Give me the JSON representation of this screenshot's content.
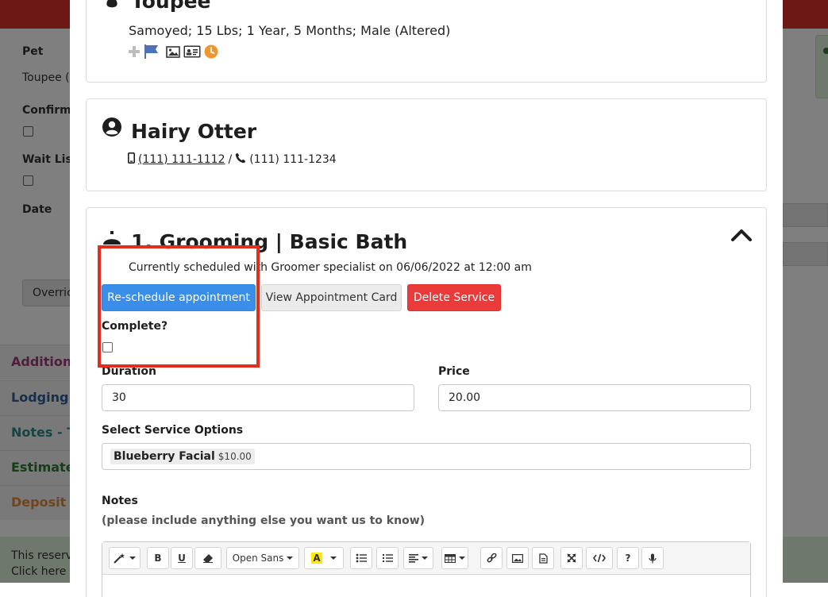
{
  "background": {
    "pet_label": "Pet",
    "pet_value": "Toupee (",
    "confirm_label": "Confirm",
    "wait_list_label": "Wait List",
    "date_label": "Date",
    "override_button": "Overric",
    "sections": [
      {
        "label": "Additiona",
        "color": "#a23a7a"
      },
      {
        "label": "Lodging -",
        "color": "#2f5f9a"
      },
      {
        "label": "Notes - To",
        "color": "#2a8a8a"
      },
      {
        "label": "Estimate",
        "color": "#2d7a2d"
      },
      {
        "label": "Deposit - ",
        "color": "#e08a3a"
      }
    ],
    "notice_line1": "This reserva",
    "notice_line2": "Click here to"
  },
  "pet": {
    "name": "Toupee",
    "details": "Samoyed; 15 Lbs; 1 Year, 5 Months; Male (Altered)",
    "icons": [
      "plus-icon",
      "flag-icon",
      "image-icon",
      "id-card-icon",
      "clock-icon"
    ],
    "icon_colors": {
      "plus": "#bdbdbd",
      "flag": "#4d72b6",
      "image": "#333333",
      "clock": "#f0962f"
    }
  },
  "owner": {
    "name": "Hairy Otter",
    "mobile": "(111) 111-1112",
    "separator": "/",
    "phone": "(111) 111-1234"
  },
  "service": {
    "title": "1. Grooming | Basic Bath",
    "schedule_text": "Currently scheduled with Groomer specialist on 06/06/2022 at 12:00 am",
    "buttons": {
      "reschedule": "Re-schedule appointment",
      "view_card": "View Appointment Card",
      "delete": "Delete Service"
    },
    "complete_label": "Complete?",
    "complete_checked": false,
    "duration_label": "Duration",
    "duration_value": "30",
    "price_label": "Price",
    "price_value": "20.00",
    "options_label": "Select Service Options",
    "selected_option": {
      "name": "Blueberry Facial",
      "price": "$10.00"
    },
    "notes_label": "Notes",
    "notes_hint": "(please include anything else you want us to know)",
    "editor_font": "Open Sans",
    "toolbar_tools": [
      "magic-wand",
      "bold",
      "underline",
      "eraser",
      "font-family",
      "highlight-color",
      "unordered-list",
      "ordered-list",
      "align",
      "table",
      "link",
      "picture",
      "file",
      "fullscreen",
      "code-view",
      "help",
      "microphone"
    ]
  },
  "colors": {
    "blue": "#3b8ee8",
    "red": "#ea3a3a",
    "highlight": "#e52d1f",
    "topbar": "#d9312b"
  }
}
